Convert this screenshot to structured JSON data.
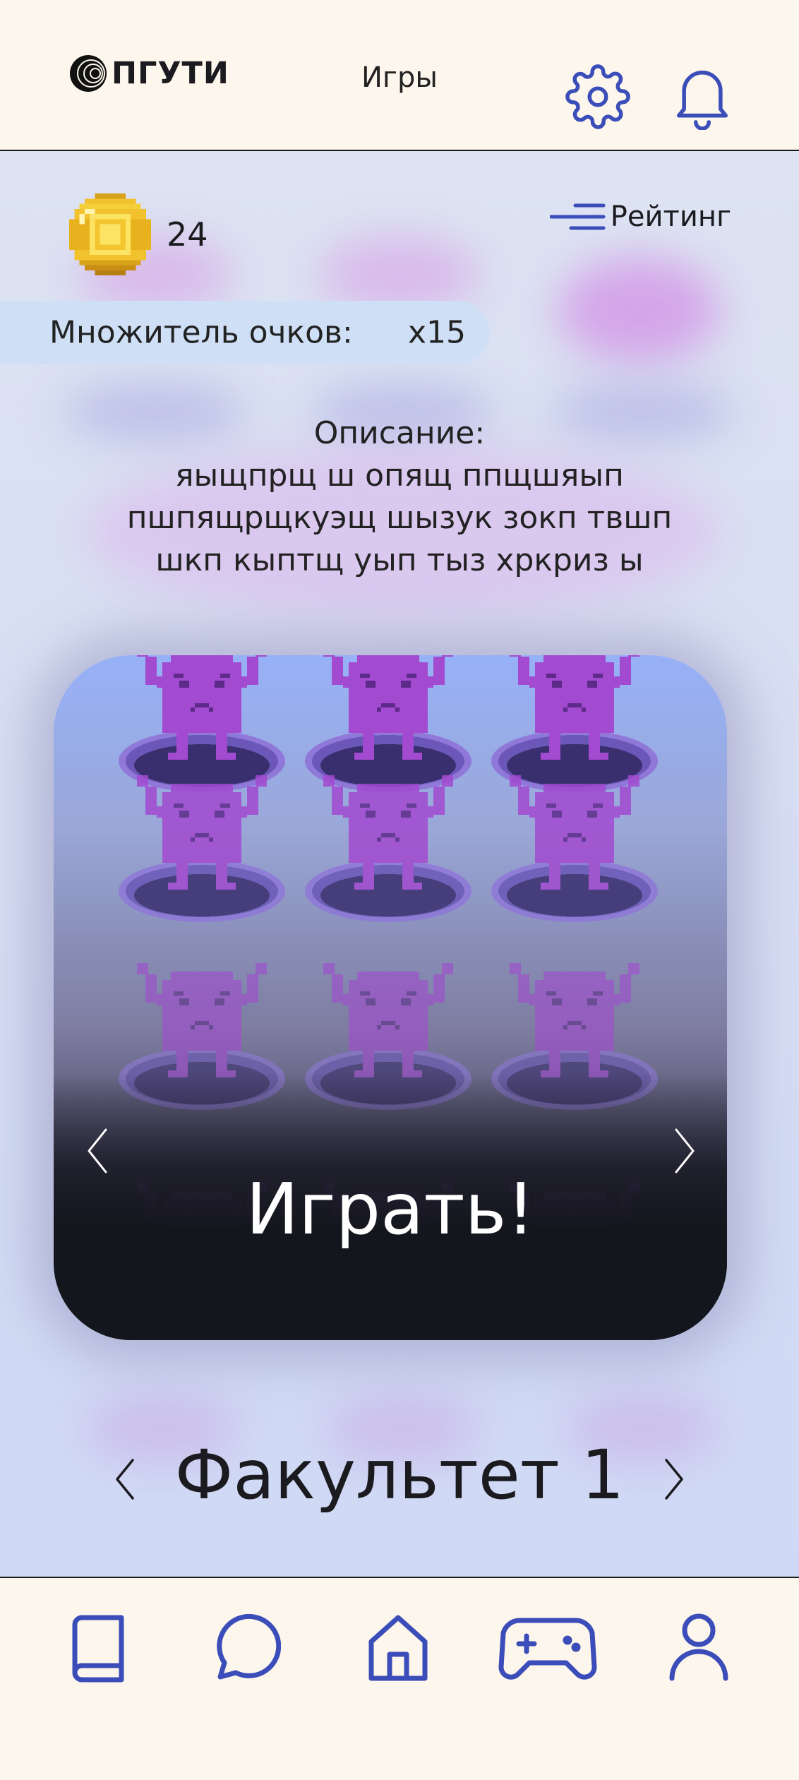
{
  "header": {
    "logo_text": "ПГУТИ",
    "title": "Игры",
    "icons": [
      "gear-icon",
      "bell-icon"
    ]
  },
  "stats": {
    "coins": "24",
    "rating_label": "Рейтинг"
  },
  "multiplier": {
    "label": "Множитель очков:",
    "value": "x15"
  },
  "description": {
    "title": "Описание:",
    "lines": [
      "яыщпрщ ш опящ ппщшяып",
      "пшпящрщкуэщ шызук  зокп твшп",
      "шкп кыптщ уып тыз хркриз ы"
    ]
  },
  "game_card": {
    "play_label": "Играть!",
    "icons": [
      "chevron-left-icon",
      "chevron-right-icon"
    ]
  },
  "faculty": {
    "name": "Факультет 1"
  },
  "tabbar": {
    "items": [
      "book-icon",
      "chat-icon",
      "home-icon",
      "gamepad-icon",
      "profile-icon"
    ],
    "active": "gamepad-icon"
  },
  "colors": {
    "accent": "#3b4db8",
    "header_bg": "#fdf6ec",
    "monster": "#a24ad0"
  }
}
